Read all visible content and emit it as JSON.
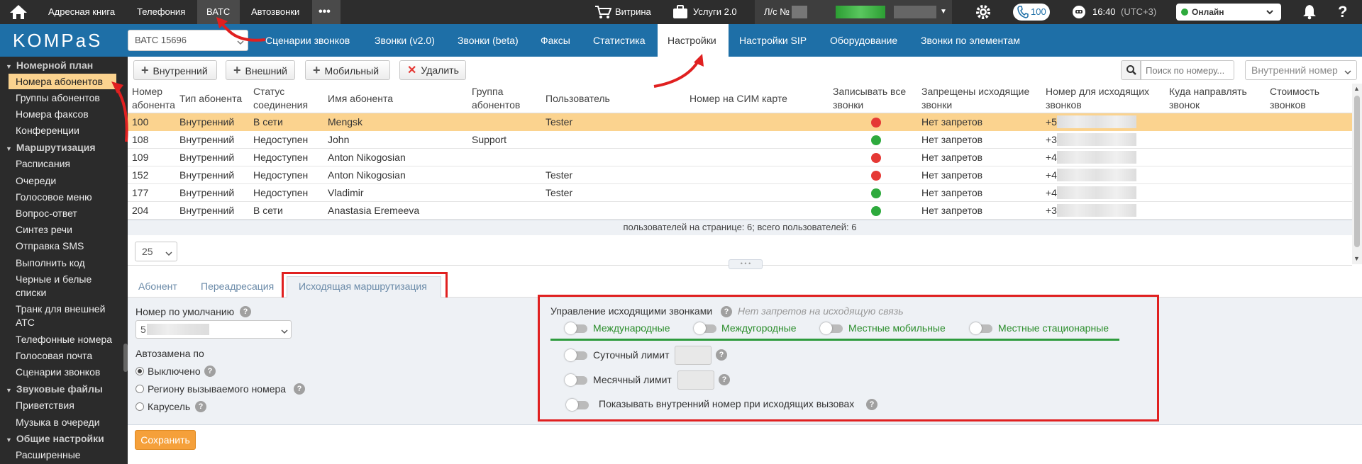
{
  "topbar": {
    "items": [
      "Адресная книга",
      "Телефония",
      "ВАТС",
      "Автозвонки"
    ],
    "more": "•••",
    "vitrina": "Витрина",
    "services": "Услуги 2.0",
    "account_label": "Л/с №",
    "calls_count": "100",
    "time": "16:40",
    "timezone": "(UTC+3)",
    "status": "Онлайн"
  },
  "navbar": {
    "logo": "KOMPaS",
    "search_value": "ВАТС 15696",
    "tabs": [
      "Сценарии звонков",
      "Звонки (v2.0)",
      "Звонки (beta)",
      "Факсы",
      "Статистика",
      "Настройки",
      "Настройки SIP",
      "Оборудование",
      "Звонки по элементам"
    ],
    "active_tab": "Настройки"
  },
  "sidebar": {
    "sections": [
      {
        "title": "Номерной план",
        "items": [
          "Номера абонентов",
          "Группы абонентов",
          "Номера факсов",
          "Конференции"
        ]
      },
      {
        "title": "Маршрутизация",
        "items": [
          "Расписания",
          "Очереди",
          "Голосовое меню",
          "Вопрос-ответ",
          "Синтез речи",
          "Отправка SMS",
          "Выполнить код",
          "Черные и белые списки",
          "Транк для внешней АТС",
          "Телефонные номера",
          "Голосовая почта",
          "Сценарии звонков"
        ]
      },
      {
        "title": "Звуковые файлы",
        "items": [
          "Приветствия",
          "Музыка в очереди"
        ]
      },
      {
        "title": "Общие настройки",
        "items": [
          "Расширенные"
        ]
      }
    ],
    "active_item": "Номера абонентов"
  },
  "toolbar": {
    "buttons": [
      "Внутренний",
      "Внешний",
      "Мобильный",
      "Удалить"
    ],
    "search_placeholder": "Поиск по номеру...",
    "filter_select": "Внутренний номер"
  },
  "table": {
    "headers": [
      "Номер абонента",
      "Тип абонента",
      "Статус соединения",
      "Имя абонента",
      "Группа абонентов",
      "Пользователь",
      "Номер на СИМ карте",
      "Записывать все звонки",
      "Запрещены исходящие звонки",
      "Номер для исходящих звонков",
      "Куда направлять звонок",
      "Стоимость звонков"
    ],
    "rows": [
      {
        "number": "100",
        "type": "Внутренний",
        "status": "В сети",
        "name": "Mengsk",
        "group": "",
        "user": "Tester",
        "sim": "",
        "record": "red",
        "restricted": "Нет запретов",
        "outgoing": "+5"
      },
      {
        "number": "108",
        "type": "Внутренний",
        "status": "Недоступен",
        "name": "John",
        "group": "Support",
        "user": "",
        "sim": "",
        "record": "green",
        "restricted": "Нет запретов",
        "outgoing": "+3"
      },
      {
        "number": "109",
        "type": "Внутренний",
        "status": "Недоступен",
        "name": "Anton Nikogosian",
        "group": "",
        "user": "",
        "sim": "",
        "record": "red",
        "restricted": "Нет запретов",
        "outgoing": "+4"
      },
      {
        "number": "152",
        "type": "Внутренний",
        "status": "Недоступен",
        "name": "Anton Nikogosian",
        "group": "",
        "user": "Tester",
        "sim": "",
        "record": "red",
        "restricted": "Нет запретов",
        "outgoing": "+4"
      },
      {
        "number": "177",
        "type": "Внутренний",
        "status": "Недоступен",
        "name": "Vladimir",
        "group": "",
        "user": "Tester",
        "sim": "",
        "record": "green",
        "restricted": "Нет запретов",
        "outgoing": "+4"
      },
      {
        "number": "204",
        "type": "Внутренний",
        "status": "В сети",
        "name": "Anastasia Eremeeva",
        "group": "",
        "user": "",
        "sim": "",
        "record": "green",
        "restricted": "Нет запретов",
        "outgoing": "+3"
      }
    ],
    "footer": "пользователей на странице: 6; всего пользователей: 6",
    "page_size": "25"
  },
  "tabs": {
    "items": [
      "Абонент",
      "Переадресация",
      "Исходящая маршрутизация"
    ],
    "active": "Исходящая маршрутизация"
  },
  "form": {
    "default_number_label": "Номер по умолчанию",
    "default_number_value": "5",
    "autoreplace_label": "Автозамена по",
    "autoreplace_options": [
      "Выключено",
      "Региону вызываемого номера",
      "Карусель"
    ],
    "autoreplace_selected": "Выключено",
    "save_label": "Сохранить"
  },
  "outgoing": {
    "title": "Управление исходящими звонками",
    "status": "Нет запретов на исходящую связь",
    "toggles": [
      "Международные",
      "Междугородные",
      "Местные мобильные",
      "Местные стационарные"
    ],
    "daily_limit": "Суточный лимит",
    "monthly_limit": "Месячный лимит",
    "show_internal": "Показывать внутренний номер при исходящих вызовах"
  },
  "colors": {
    "topbar": "#2d2d2d",
    "navbar": "#1e6fa7",
    "sidebar": "#2b2b2b",
    "highlight_row": "#fbd38f",
    "accent_orange": "#f5a03a",
    "annotation_red": "#e02020",
    "green_line": "#2e9b3d"
  }
}
